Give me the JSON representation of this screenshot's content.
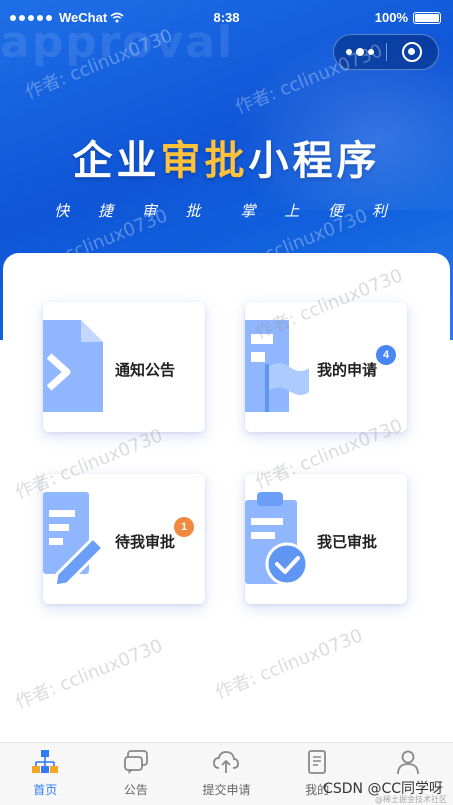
{
  "status_bar": {
    "carrier": "WeChat",
    "time": "8:38",
    "battery": "100%"
  },
  "hero": {
    "bg_text": "approval",
    "title_part1": "企业",
    "title_highlight": "审批",
    "title_part2": "小程序",
    "subtitle_a": "快 捷 审 批",
    "subtitle_b": "掌 上 便 利"
  },
  "cards": [
    {
      "label": "通知公告",
      "icon": "document-icon",
      "badge": ""
    },
    {
      "label": "我的申请",
      "icon": "flag-icon",
      "badge": "4"
    },
    {
      "label": "待我审批",
      "icon": "pen-document-icon",
      "badge": "1"
    },
    {
      "label": "我已审批",
      "icon": "clipboard-check-icon",
      "badge": ""
    }
  ],
  "colors": {
    "accent": "#2f7cf6",
    "highlight": "#ffc23a",
    "icon_fill": "#8fb6ff",
    "badge_blue": "#4a87f5",
    "badge_orange": "#f0883e"
  },
  "watermark_text": "作者: cclinux0730",
  "tabbar": [
    {
      "label": "首页",
      "icon": "org-chart-icon",
      "active": true
    },
    {
      "label": "公告",
      "icon": "chat-bubbles-icon",
      "active": false
    },
    {
      "label": "提交申请",
      "icon": "cloud-upload-icon",
      "active": false
    },
    {
      "label": "我的",
      "icon": "document-list-icon",
      "active": false
    },
    {
      "label": "",
      "icon": "user-icon",
      "active": false
    }
  ],
  "credit": "CSDN @CC同学呀",
  "credit_sub": "@稀土掘金技术社区"
}
